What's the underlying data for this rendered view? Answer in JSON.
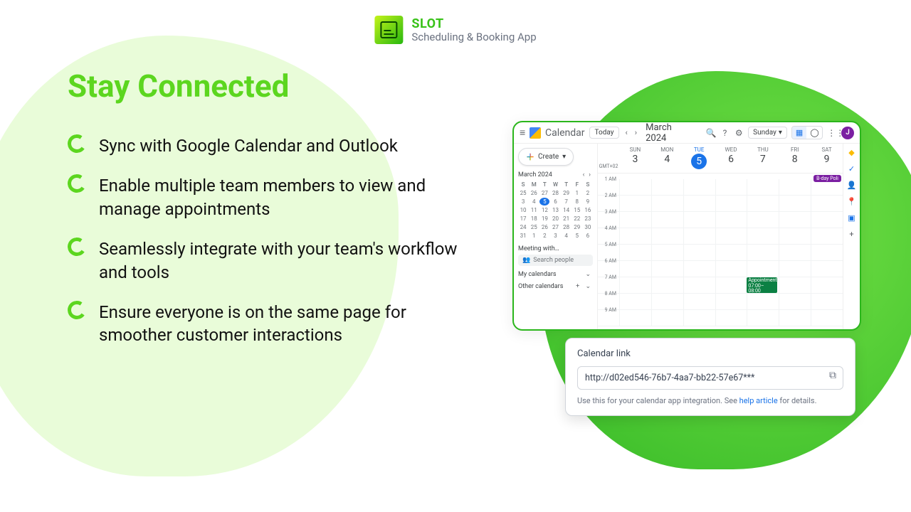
{
  "brand": {
    "title": "SLOT",
    "subtitle": "Scheduling & Booking App"
  },
  "headline": "Stay Connected",
  "bullets": [
    "Sync with Google Calendar and Outlook",
    "Enable multiple team members to view and manage appointments",
    "Seamlessly integrate with your team's workflow and tools",
    "Ensure everyone is on the same page for smoother customer interactions"
  ],
  "calendar": {
    "app_name": "Calendar",
    "today_label": "Today",
    "month_label": "March 2024",
    "view_label": "Sunday",
    "avatar_initial": "J",
    "create_label": "Create",
    "timezone": "GMT+02",
    "mini": {
      "month": "March 2024",
      "dow": [
        "S",
        "M",
        "T",
        "W",
        "T",
        "F",
        "S"
      ],
      "weeks": [
        [
          "25",
          "26",
          "27",
          "28",
          "29",
          "1",
          "2"
        ],
        [
          "3",
          "4",
          "5",
          "6",
          "7",
          "8",
          "9"
        ],
        [
          "10",
          "11",
          "12",
          "13",
          "14",
          "15",
          "16"
        ],
        [
          "17",
          "18",
          "19",
          "20",
          "21",
          "22",
          "23"
        ],
        [
          "24",
          "25",
          "26",
          "27",
          "28",
          "29",
          "30"
        ],
        [
          "31",
          "1",
          "2",
          "3",
          "4",
          "5",
          "6"
        ]
      ],
      "today": "5"
    },
    "meeting_with": "Meeting with…",
    "search_people": "Search people",
    "my_calendars": "My calendars",
    "other_calendars": "Other calendars",
    "days": [
      {
        "name": "SUN",
        "num": "3"
      },
      {
        "name": "MON",
        "num": "4"
      },
      {
        "name": "TUE",
        "num": "5",
        "today": true
      },
      {
        "name": "WED",
        "num": "6"
      },
      {
        "name": "THU",
        "num": "7"
      },
      {
        "name": "FRI",
        "num": "8"
      },
      {
        "name": "SAT",
        "num": "9"
      }
    ],
    "hours": [
      "1 AM",
      "2 AM",
      "3 AM",
      "4 AM",
      "5 AM",
      "6 AM",
      "7 AM",
      "8 AM",
      "9 AM"
    ],
    "bday_label": "B-day Poli",
    "appointment": {
      "title": "Appointment",
      "time": "07:00–08:00"
    }
  },
  "link_card": {
    "title": "Calendar link",
    "url": "http://d02ed546-76b7-4aa7-bb22-57e67***",
    "help_pre": "Use this for your calendar app integration. See ",
    "help_link": "help article",
    "help_post": " for details."
  }
}
